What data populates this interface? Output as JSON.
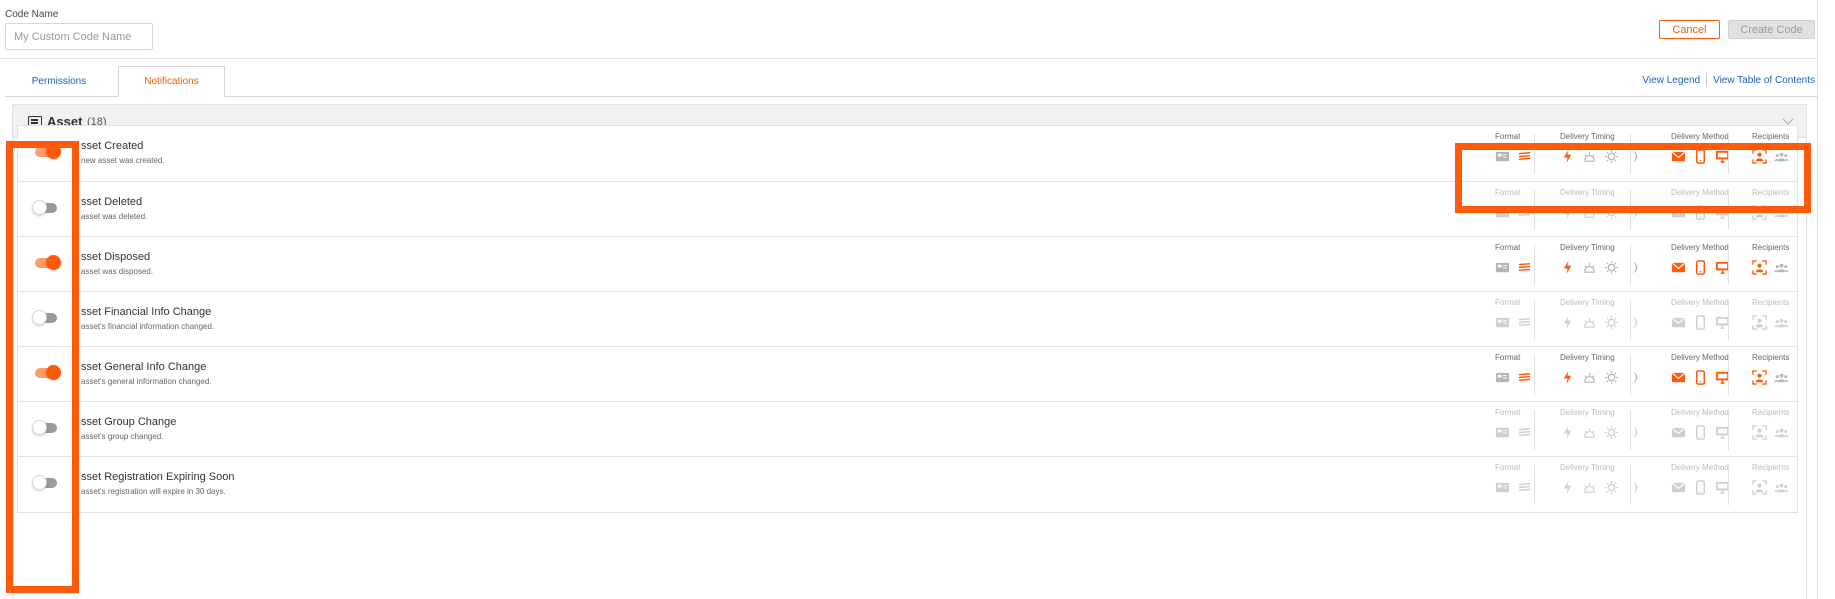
{
  "code_name": {
    "label": "Code Name",
    "placeholder": "My Custom Code Name",
    "value": ""
  },
  "actions": {
    "cancel_label": "Cancel",
    "create_label": "Create Code"
  },
  "tabs": [
    {
      "label": "Permissions",
      "active": false
    },
    {
      "label": "Notifications",
      "active": true
    }
  ],
  "links": {
    "legend": "View Legend",
    "toc": "View Table of Contents"
  },
  "group": {
    "title": "Asset",
    "count": "(18)",
    "icon": "list-icon"
  },
  "settings_labels": {
    "format": "Format",
    "timing": "Delivery Timing",
    "method": "Delivery Method",
    "recipients": "Recipients"
  },
  "colors": {
    "accent": "#ff5a0a",
    "link": "#1f5fb8",
    "inactive_icon": "#cfcfcf",
    "active_gray_icon": "#b5b5b5"
  },
  "rows": [
    {
      "title": "sset Created",
      "desc": "new asset was created.",
      "enabled": true
    },
    {
      "title": "sset Deleted",
      "desc": "asset was deleted.",
      "enabled": false
    },
    {
      "title": "sset Disposed",
      "desc": "asset was disposed.",
      "enabled": true
    },
    {
      "title": "sset Financial Info Change",
      "desc": "asset's financial information changed.",
      "enabled": false
    },
    {
      "title": "sset General Info Change",
      "desc": "asset's general information changed.",
      "enabled": true
    },
    {
      "title": "sset Group Change",
      "desc": "asset's group changed.",
      "enabled": false
    },
    {
      "title": "sset Registration Expiring Soon",
      "desc": "asset's registration will expire in 30 days.",
      "enabled": false
    }
  ]
}
